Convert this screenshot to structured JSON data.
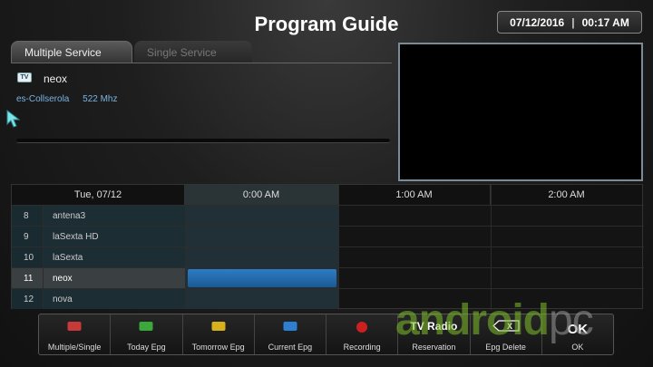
{
  "header": {
    "title": "Program Guide",
    "date": "07/12/2016",
    "separator": "|",
    "time": "00:17 AM"
  },
  "tabs": [
    {
      "label": "Multiple Service",
      "active": true
    },
    {
      "label": "Single Service",
      "active": false
    }
  ],
  "service": {
    "icon_label": "TV",
    "name": "neox",
    "network": "es-Collserola",
    "frequency": "522 Mhz",
    "progress": 0.0
  },
  "grid": {
    "date_header": "Tue, 07/12",
    "time_headers": [
      "0:00 AM",
      "1:00 AM",
      "2:00 AM"
    ],
    "rows": [
      {
        "num": "8",
        "name": "antena3"
      },
      {
        "num": "9",
        "name": "laSexta HD"
      },
      {
        "num": "10",
        "name": "laSexta"
      },
      {
        "num": "11",
        "name": "neox"
      },
      {
        "num": "12",
        "name": "nova"
      }
    ],
    "selected_row": 3
  },
  "toolbar": {
    "buttons": [
      {
        "label": "Multiple/Single",
        "icon": "red-square-icon",
        "color": "#c83a3a"
      },
      {
        "label": "Today Epg",
        "icon": "green-square-icon",
        "color": "#3aa83a"
      },
      {
        "label": "Tomorrow Epg",
        "icon": "yellow-square-icon",
        "color": "#d8b21c"
      },
      {
        "label": "Current Epg",
        "icon": "blue-square-icon",
        "color": "#2f7fd0"
      },
      {
        "label": "Recording",
        "icon": "record-dot-icon",
        "color": "#cc1f1f"
      },
      {
        "label": "Reservation",
        "icon": "tv-radio-icon",
        "icon_text": "TV Radio"
      },
      {
        "label": "Epg Delete",
        "icon": "delete-key-icon",
        "icon_text": "X"
      },
      {
        "label": "OK",
        "icon": "ok-icon",
        "icon_text": "OK"
      }
    ]
  },
  "watermark": {
    "part1": "android",
    "part2": "pc"
  }
}
